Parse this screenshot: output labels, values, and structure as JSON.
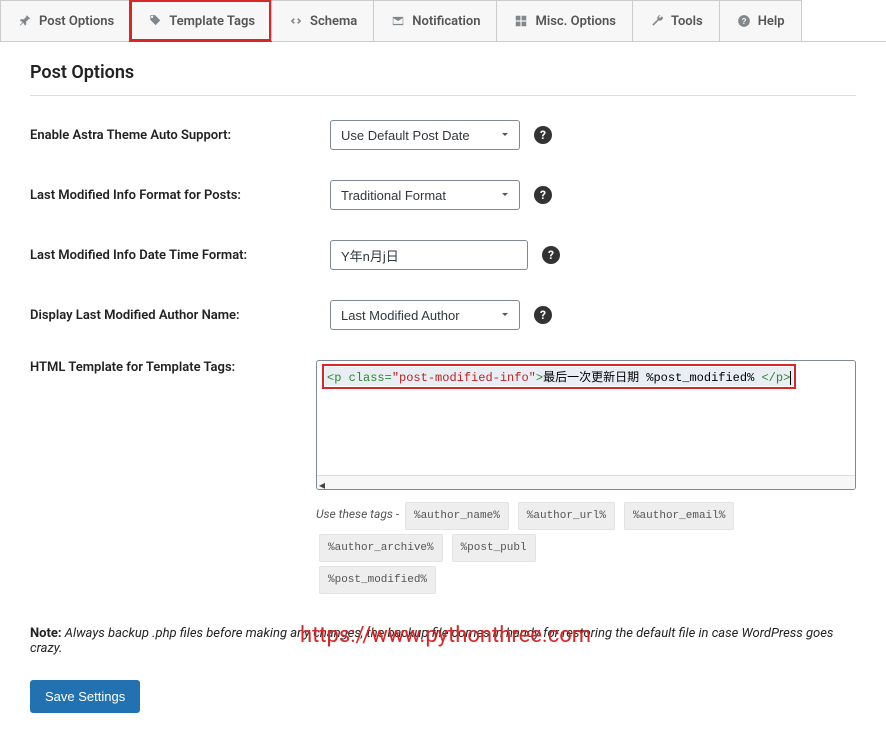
{
  "tabs": [
    {
      "label": "Post Options",
      "icon": "pin"
    },
    {
      "label": "Template Tags",
      "icon": "tag"
    },
    {
      "label": "Schema",
      "icon": "code"
    },
    {
      "label": "Notification",
      "icon": "mail"
    },
    {
      "label": "Misc. Options",
      "icon": "grid"
    },
    {
      "label": "Tools",
      "icon": "wrench"
    },
    {
      "label": "Help",
      "icon": "help"
    }
  ],
  "section_title": "Post Options",
  "fields": {
    "astra": {
      "label": "Enable Astra Theme Auto Support:",
      "value": "Use Default Post Date"
    },
    "format": {
      "label": "Last Modified Info Format for Posts:",
      "value": "Traditional Format"
    },
    "datetime": {
      "label": "Last Modified Info Date Time Format:",
      "value": "Y年n月j日"
    },
    "author": {
      "label": "Display Last Modified Author Name:",
      "value": "Last Modified Author"
    },
    "template": {
      "label": "HTML Template for Template Tags:"
    }
  },
  "code": {
    "open_tag": "<p ",
    "class_kw": "class=",
    "class_val": "\"post-modified-info\"",
    "gt": ">",
    "text": "最后一次更新日期 %post_modified% ",
    "close_tag": "</p>"
  },
  "tag_help_prefix": "Use these tags - ",
  "tag_chips": [
    "%author_name%",
    "%author_url%",
    "%author_email%",
    "%author_archive%",
    "%post_publ",
    "%post_modified%"
  ],
  "note_label": "Note:",
  "note_text": " Always backup .php files before making any changes, the backup file comes in handy for restoring the default file in case WordPress goes crazy.",
  "save_label": "Save Settings",
  "watermark": "https://www.pythonthree.com"
}
